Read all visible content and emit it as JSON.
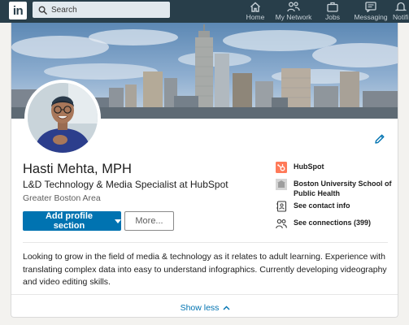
{
  "nav": {
    "logo_text": "in",
    "search_placeholder": "Search",
    "items": [
      {
        "label": "Home",
        "icon": "home-icon"
      },
      {
        "label": "My Network",
        "icon": "my-network-icon"
      },
      {
        "label": "Jobs",
        "icon": "jobs-icon"
      },
      {
        "label": "Messaging",
        "icon": "messaging-icon"
      },
      {
        "label": "Notifi",
        "icon": "notifications-icon"
      }
    ]
  },
  "profile": {
    "name": "Hasti Mehta, MPH",
    "headline": "L&D Technology & Media Specialist at HubSpot",
    "location": "Greater Boston Area",
    "add_section_label": "Add profile section",
    "more_label": "More...",
    "side": {
      "company": "HubSpot",
      "school": "Boston University School of Public Health",
      "contact": "See contact info",
      "connections": "See connections (399)"
    },
    "summary": "Looking to grow in the field of media & technology as it relates to adult learning. Experience with translating complex data into easy to understand infographics. Currently developing videography and video editing skills.",
    "show_less_label": "Show less"
  },
  "colors": {
    "nav_bg": "#283e4a",
    "primary": "#0073b1",
    "hubspot": "#ff7a59"
  }
}
